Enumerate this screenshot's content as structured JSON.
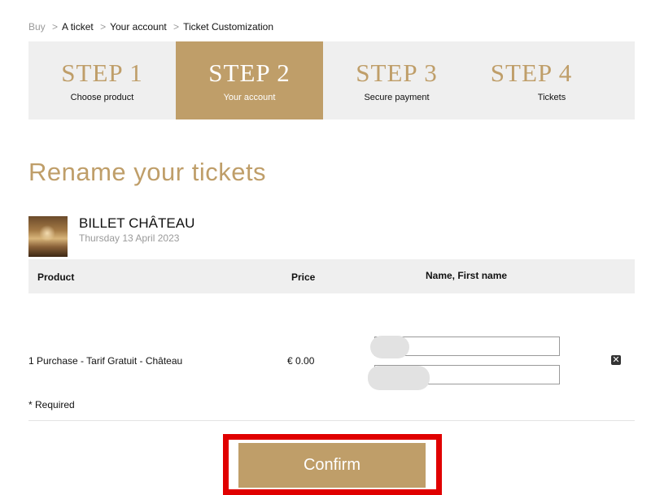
{
  "breadcrumb": {
    "buy": "Buy",
    "sep1": ">",
    "ticket": "A ticket",
    "sep2": ">",
    "account": "Your account",
    "sep3": ">",
    "customization": "Ticket Customization"
  },
  "steps": [
    {
      "num": "STEP 1",
      "label": "Choose product",
      "active": false
    },
    {
      "num": "STEP 2",
      "label": "Your account",
      "active": true
    },
    {
      "num": "STEP 3",
      "label": "Secure payment",
      "active": false
    },
    {
      "num": "STEP 4",
      "label": "Tickets",
      "active": false
    }
  ],
  "page_title": "Rename your tickets",
  "ticket": {
    "name": "BILLET CHÂTEAU",
    "date": "Thursday 13 April 2023"
  },
  "table": {
    "headers": {
      "product": "Product",
      "price": "Price",
      "name": "Name, First name"
    },
    "row": {
      "product": "1 Purchase - Tarif Gratuit - Château",
      "price": "€ 0.00",
      "name_value": "",
      "first_name_value": ""
    }
  },
  "remove_glyph": "✕",
  "required_note": "* Required",
  "confirm_label": "Confirm",
  "colors": {
    "accent": "#bf9e69",
    "panel": "#efefef",
    "highlight": "#e00000"
  }
}
